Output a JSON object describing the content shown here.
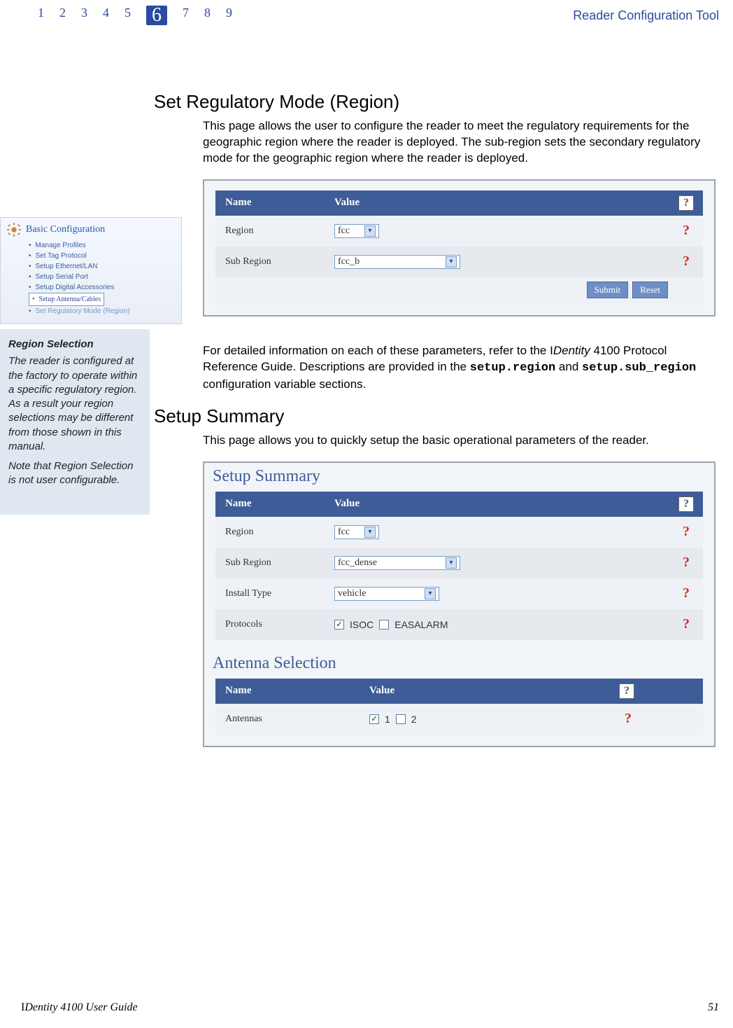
{
  "header": {
    "nums": [
      "1",
      "2",
      "3",
      "4",
      "5",
      "6",
      "7",
      "8",
      "9"
    ],
    "current": "6",
    "right": "Reader Configuration Tool"
  },
  "h1": "Set Regulatory Mode (Region)",
  "p1": "This page allows the user to configure the reader to meet the regulatory requirements for the geographic region where the reader is deployed. The sub-region sets the secondary regulatory mode for the geographic region where the reader is deployed.",
  "p2a": "For detailed information on each of these parameters, refer to the ",
  "p2ref": "IDentity 4100 Protocol Reference Guide",
  "p2b": ".  Descriptions are provided in the ",
  "p2c1": "setup.region",
  "p2mid": " and ",
  "p2c2": "setup.sub_region",
  "p2d": " configuration variable sections.",
  "h2": "Setup Summary",
  "p3": "This page allows you to quickly setup the basic operational parameters of the reader.",
  "basic": {
    "title": "Basic Configuration",
    "items": [
      "Manage Profiles",
      "Set Tag Protocol",
      "Setup Ethernet/LAN",
      "Setup Serial Port",
      "Setup Digital Accessories",
      "Setup Antenna/Cables",
      "Set Regulatory Mode (Region)"
    ]
  },
  "note": {
    "title": "Region Selection",
    "p1": "The reader is configured at the factory to operate within a specific regulatory region. As a result your region selections may be different from those shown in this manual.",
    "p2": "Note that Region Selection is not user configurable."
  },
  "panel1": {
    "name_h": "Name",
    "value_h": "Value",
    "rows": [
      {
        "name": "Region",
        "value": "fcc",
        "w": "w1"
      },
      {
        "name": "Sub Region",
        "value": "fcc_b",
        "w": "w2"
      }
    ],
    "submit": "Submit",
    "reset": "Reset"
  },
  "panel2": {
    "title": "Setup Summary",
    "name_h": "Name",
    "value_h": "Value",
    "rows": [
      {
        "name": "Region",
        "value": "fcc",
        "w": "w1"
      },
      {
        "name": "Sub Region",
        "value": "fcc_dense",
        "w": "w2"
      },
      {
        "name": "Install Type",
        "value": "vehicle",
        "w": "w3"
      }
    ],
    "proto_label": "Protocols",
    "proto_opts": [
      "ISOC",
      "EASALARM"
    ],
    "antenna_title": "Antenna Selection",
    "antenna_name_h": "Name",
    "antenna_value_h": "Value",
    "antenna_row": {
      "name": "Antennas",
      "opts": [
        "1",
        "2"
      ]
    }
  },
  "footer": {
    "left": "IDentity 4100 User Guide",
    "right": "51"
  }
}
